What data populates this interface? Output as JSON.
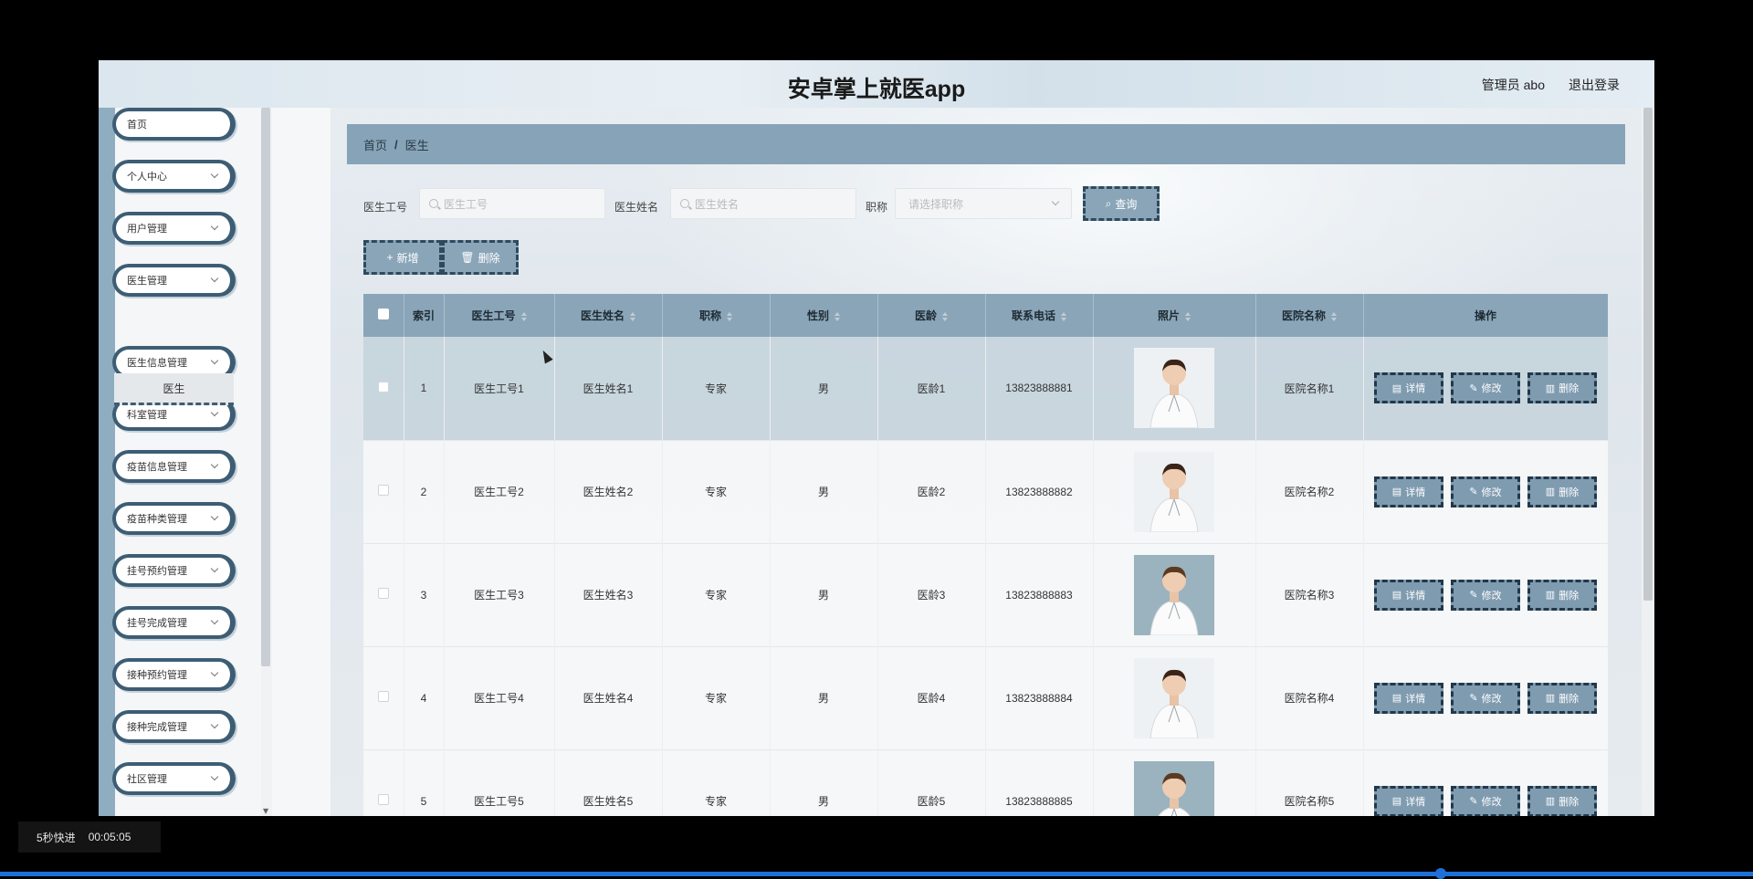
{
  "header": {
    "title": "安卓掌上就医app",
    "user": "管理员 abo",
    "logout": "退出登录"
  },
  "sidebar": {
    "items": [
      {
        "label": "首页",
        "has_children": false
      },
      {
        "label": "个人中心",
        "has_children": true
      },
      {
        "label": "用户管理",
        "has_children": true
      },
      {
        "label": "医生管理",
        "has_children": true
      },
      {
        "label": "医生信息管理",
        "has_children": true
      },
      {
        "label": "科室管理",
        "has_children": true
      },
      {
        "label": "疫苗信息管理",
        "has_children": true
      },
      {
        "label": "疫苗种类管理",
        "has_children": true
      },
      {
        "label": "挂号预约管理",
        "has_children": true
      },
      {
        "label": "挂号完成管理",
        "has_children": true
      },
      {
        "label": "接种预约管理",
        "has_children": true
      },
      {
        "label": "接种完成管理",
        "has_children": true
      },
      {
        "label": "社区管理",
        "has_children": true
      }
    ],
    "active_sub": "医生"
  },
  "breadcrumb": {
    "home": "首页",
    "sep": "/",
    "current": "医生"
  },
  "search": {
    "f1_label": "医生工号",
    "f1_placeholder": "医生工号",
    "f2_label": "医生姓名",
    "f2_placeholder": "医生姓名",
    "f3_label": "职称",
    "f3_placeholder": "请选择职称",
    "query": "查询"
  },
  "actions": {
    "add": "新增",
    "delete": "删除"
  },
  "table": {
    "columns": [
      "索引",
      "医生工号",
      "医生姓名",
      "职称",
      "性别",
      "医龄",
      "联系电话",
      "照片",
      "医院名称",
      "操作"
    ],
    "rows": [
      {
        "idx": "1",
        "code": "医生工号1",
        "name": "医生姓名1",
        "title": "专家",
        "gender": "男",
        "age": "医龄1",
        "phone": "13823888881",
        "hospital": "医院名称1",
        "photo": "female-doctor"
      },
      {
        "idx": "2",
        "code": "医生工号2",
        "name": "医生姓名2",
        "title": "专家",
        "gender": "男",
        "age": "医龄2",
        "phone": "13823888882",
        "hospital": "医院名称2",
        "photo": "female-doctor"
      },
      {
        "idx": "3",
        "code": "医生工号3",
        "name": "医生姓名3",
        "title": "专家",
        "gender": "男",
        "age": "医龄3",
        "phone": "13823888883",
        "hospital": "医院名称3",
        "photo": "male-doctor"
      },
      {
        "idx": "4",
        "code": "医生工号4",
        "name": "医生姓名4",
        "title": "专家",
        "gender": "男",
        "age": "医龄4",
        "phone": "13823888884",
        "hospital": "医院名称4",
        "photo": "female-doctor-2"
      },
      {
        "idx": "5",
        "code": "医生工号5",
        "name": "医生姓名5",
        "title": "专家",
        "gender": "男",
        "age": "医龄5",
        "phone": "13823888885",
        "hospital": "医院名称5",
        "photo": "male-doctor"
      }
    ],
    "op_labels": {
      "detail": "详情",
      "edit": "修改",
      "delete": "删除"
    }
  },
  "player": {
    "skip": "5秒快进",
    "time": "00:05:05"
  },
  "colors": {
    "accent": "#8aa5b8",
    "dark": "#2e4a5e",
    "progress": "#1e6fd8"
  }
}
